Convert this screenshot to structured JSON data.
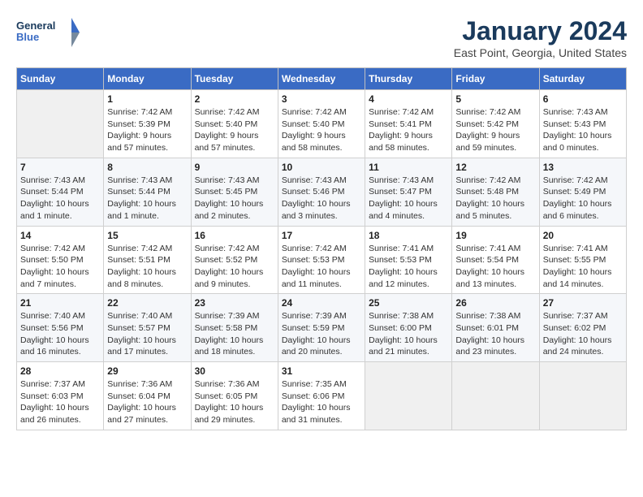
{
  "logo": {
    "line1": "General",
    "line2": "Blue"
  },
  "title": "January 2024",
  "subtitle": "East Point, Georgia, United States",
  "days_of_week": [
    "Sunday",
    "Monday",
    "Tuesday",
    "Wednesday",
    "Thursday",
    "Friday",
    "Saturday"
  ],
  "weeks": [
    [
      {
        "day": "",
        "info": ""
      },
      {
        "day": "1",
        "info": "Sunrise: 7:42 AM\nSunset: 5:39 PM\nDaylight: 9 hours\nand 57 minutes."
      },
      {
        "day": "2",
        "info": "Sunrise: 7:42 AM\nSunset: 5:40 PM\nDaylight: 9 hours\nand 57 minutes."
      },
      {
        "day": "3",
        "info": "Sunrise: 7:42 AM\nSunset: 5:40 PM\nDaylight: 9 hours\nand 58 minutes."
      },
      {
        "day": "4",
        "info": "Sunrise: 7:42 AM\nSunset: 5:41 PM\nDaylight: 9 hours\nand 58 minutes."
      },
      {
        "day": "5",
        "info": "Sunrise: 7:42 AM\nSunset: 5:42 PM\nDaylight: 9 hours\nand 59 minutes."
      },
      {
        "day": "6",
        "info": "Sunrise: 7:43 AM\nSunset: 5:43 PM\nDaylight: 10 hours\nand 0 minutes."
      }
    ],
    [
      {
        "day": "7",
        "info": "Sunrise: 7:43 AM\nSunset: 5:44 PM\nDaylight: 10 hours\nand 1 minute."
      },
      {
        "day": "8",
        "info": "Sunrise: 7:43 AM\nSunset: 5:44 PM\nDaylight: 10 hours\nand 1 minute."
      },
      {
        "day": "9",
        "info": "Sunrise: 7:43 AM\nSunset: 5:45 PM\nDaylight: 10 hours\nand 2 minutes."
      },
      {
        "day": "10",
        "info": "Sunrise: 7:43 AM\nSunset: 5:46 PM\nDaylight: 10 hours\nand 3 minutes."
      },
      {
        "day": "11",
        "info": "Sunrise: 7:43 AM\nSunset: 5:47 PM\nDaylight: 10 hours\nand 4 minutes."
      },
      {
        "day": "12",
        "info": "Sunrise: 7:42 AM\nSunset: 5:48 PM\nDaylight: 10 hours\nand 5 minutes."
      },
      {
        "day": "13",
        "info": "Sunrise: 7:42 AM\nSunset: 5:49 PM\nDaylight: 10 hours\nand 6 minutes."
      }
    ],
    [
      {
        "day": "14",
        "info": "Sunrise: 7:42 AM\nSunset: 5:50 PM\nDaylight: 10 hours\nand 7 minutes."
      },
      {
        "day": "15",
        "info": "Sunrise: 7:42 AM\nSunset: 5:51 PM\nDaylight: 10 hours\nand 8 minutes."
      },
      {
        "day": "16",
        "info": "Sunrise: 7:42 AM\nSunset: 5:52 PM\nDaylight: 10 hours\nand 9 minutes."
      },
      {
        "day": "17",
        "info": "Sunrise: 7:42 AM\nSunset: 5:53 PM\nDaylight: 10 hours\nand 11 minutes."
      },
      {
        "day": "18",
        "info": "Sunrise: 7:41 AM\nSunset: 5:53 PM\nDaylight: 10 hours\nand 12 minutes."
      },
      {
        "day": "19",
        "info": "Sunrise: 7:41 AM\nSunset: 5:54 PM\nDaylight: 10 hours\nand 13 minutes."
      },
      {
        "day": "20",
        "info": "Sunrise: 7:41 AM\nSunset: 5:55 PM\nDaylight: 10 hours\nand 14 minutes."
      }
    ],
    [
      {
        "day": "21",
        "info": "Sunrise: 7:40 AM\nSunset: 5:56 PM\nDaylight: 10 hours\nand 16 minutes."
      },
      {
        "day": "22",
        "info": "Sunrise: 7:40 AM\nSunset: 5:57 PM\nDaylight: 10 hours\nand 17 minutes."
      },
      {
        "day": "23",
        "info": "Sunrise: 7:39 AM\nSunset: 5:58 PM\nDaylight: 10 hours\nand 18 minutes."
      },
      {
        "day": "24",
        "info": "Sunrise: 7:39 AM\nSunset: 5:59 PM\nDaylight: 10 hours\nand 20 minutes."
      },
      {
        "day": "25",
        "info": "Sunrise: 7:38 AM\nSunset: 6:00 PM\nDaylight: 10 hours\nand 21 minutes."
      },
      {
        "day": "26",
        "info": "Sunrise: 7:38 AM\nSunset: 6:01 PM\nDaylight: 10 hours\nand 23 minutes."
      },
      {
        "day": "27",
        "info": "Sunrise: 7:37 AM\nSunset: 6:02 PM\nDaylight: 10 hours\nand 24 minutes."
      }
    ],
    [
      {
        "day": "28",
        "info": "Sunrise: 7:37 AM\nSunset: 6:03 PM\nDaylight: 10 hours\nand 26 minutes."
      },
      {
        "day": "29",
        "info": "Sunrise: 7:36 AM\nSunset: 6:04 PM\nDaylight: 10 hours\nand 27 minutes."
      },
      {
        "day": "30",
        "info": "Sunrise: 7:36 AM\nSunset: 6:05 PM\nDaylight: 10 hours\nand 29 minutes."
      },
      {
        "day": "31",
        "info": "Sunrise: 7:35 AM\nSunset: 6:06 PM\nDaylight: 10 hours\nand 31 minutes."
      },
      {
        "day": "",
        "info": ""
      },
      {
        "day": "",
        "info": ""
      },
      {
        "day": "",
        "info": ""
      }
    ]
  ]
}
